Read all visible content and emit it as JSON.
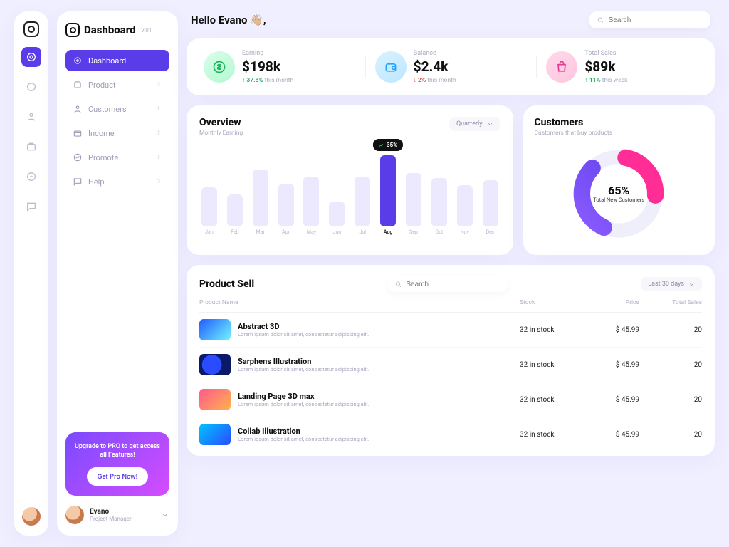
{
  "brand": {
    "title": "Dashboard",
    "version": "v.01"
  },
  "rail_icons": [
    "logo",
    "dashboard",
    "product",
    "customers",
    "income",
    "promote",
    "help"
  ],
  "sidebar": {
    "items": [
      {
        "label": "Dashboard"
      },
      {
        "label": "Product"
      },
      {
        "label": "Customers"
      },
      {
        "label": "Income"
      },
      {
        "label": "Promote"
      },
      {
        "label": "Help"
      }
    ],
    "pro": {
      "text": "Upgrade to  PRO to get access all Features!",
      "button": "Get Pro Now!"
    },
    "user": {
      "name": "Evano",
      "role": "Project Manager"
    }
  },
  "greeting": "Hello Evano 👋🏼,",
  "search_placeholder": "Search",
  "kpi": [
    {
      "label": "Earning",
      "value": "$198k",
      "delta": "37.8%",
      "direction": "up",
      "period": "this month"
    },
    {
      "label": "Balance",
      "value": "$2.4k",
      "delta": "2%",
      "direction": "down",
      "period": "this month"
    },
    {
      "label": "Total Sales",
      "value": "$89k",
      "delta": "11%",
      "direction": "up",
      "period": "this week"
    }
  ],
  "overview": {
    "title": "Overview",
    "subtitle": "Monthly Earning",
    "period": "Quarterly",
    "tooltip": "35%",
    "highlight_index": 7
  },
  "customers_card": {
    "title": "Customers",
    "subtitle": "Customers that buy products",
    "center_value": "65%",
    "center_label": "Total New Customers"
  },
  "product_table": {
    "title": "Product Sell",
    "search_placeholder": "Search",
    "period": "Last 30 days",
    "columns": [
      "Product Name",
      "Stock",
      "Price",
      "Total Sales"
    ],
    "rows": [
      {
        "name": "Abstract 3D",
        "desc": "Lorem ipsum dolor sit amet, consectetur adipiscing elit.",
        "stock": "32 in stock",
        "price": "$ 45.99",
        "sales": "20"
      },
      {
        "name": "Sarphens Illustration",
        "desc": "Lorem ipsum dolor sit amet, consectetur adipiscing elit.",
        "stock": "32 in stock",
        "price": "$ 45.99",
        "sales": "20"
      },
      {
        "name": "Landing Page 3D max",
        "desc": "Lorem ipsum dolor sit amet, consectetur adipiscing elit.",
        "stock": "32 in stock",
        "price": "$ 45.99",
        "sales": "20"
      },
      {
        "name": "Collab Illustration",
        "desc": "Lorem ipsum dolor sit amet, consectetur adipiscing elit.",
        "stock": "32 in stock",
        "price": "$ 45.99",
        "sales": "20"
      }
    ]
  },
  "chart_data": {
    "type": "bar",
    "categories": [
      "Jan",
      "Feb",
      "Mar",
      "Apr",
      "May",
      "Jun",
      "Jul",
      "Aug",
      "Sep",
      "Oct",
      "Nov",
      "Dec"
    ],
    "values": [
      55,
      45,
      80,
      60,
      70,
      35,
      70,
      100,
      75,
      68,
      58,
      65
    ],
    "highlight_category": "Aug",
    "highlight_delta": "35%",
    "title": "Overview",
    "subtitle": "Monthly Earning",
    "ylim": [
      0,
      100
    ]
  }
}
